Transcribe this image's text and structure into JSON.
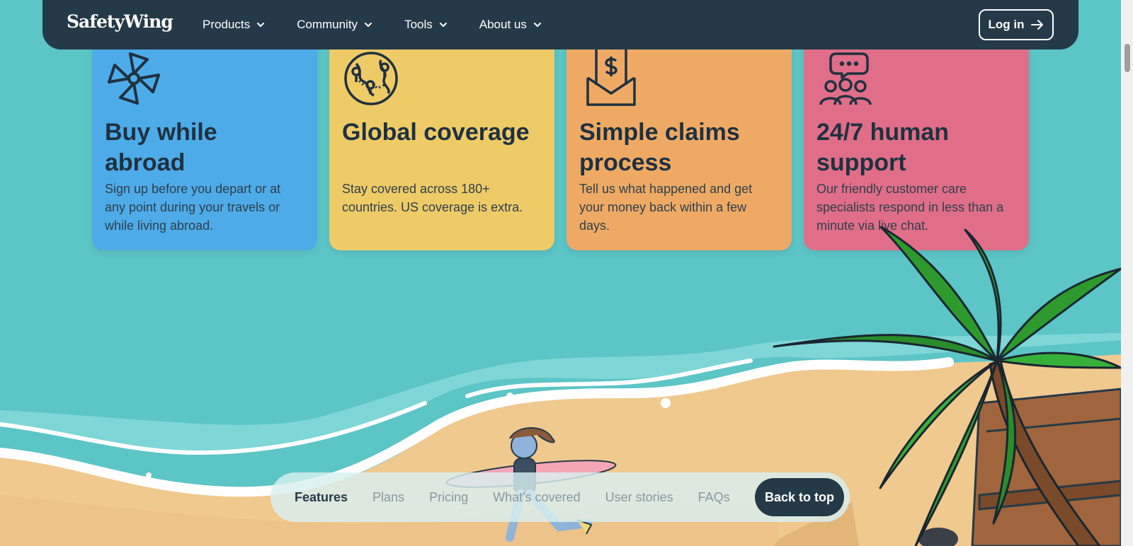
{
  "header": {
    "logo": "SafetyWing",
    "menu": [
      {
        "label": "Products"
      },
      {
        "label": "Community"
      },
      {
        "label": "Tools"
      },
      {
        "label": "About us"
      }
    ],
    "login_label": "Log in"
  },
  "features": [
    {
      "icon": "pinwheel-icon",
      "color": "#4eabe9",
      "title": "Buy while abroad",
      "text": "Sign up before you depart or at any point during your travels or while living abroad."
    },
    {
      "icon": "globe-map-icon",
      "color": "#eecb67",
      "title": "Global coverage",
      "text": "Stay covered across 180+ countries. US coverage is extra."
    },
    {
      "icon": "money-envelope-icon",
      "color": "#eeaa65",
      "title": "Simple claims process",
      "text": "Tell us what happened and get your money back within a few days."
    },
    {
      "icon": "support-chat-icon",
      "color": "#e06e88",
      "title": "24/7 human support",
      "text": "Our friendly customer care specialists respond in less than a minute via live chat."
    }
  ],
  "section_nav": {
    "items": [
      "Features",
      "Plans",
      "Pricing",
      "What's covered",
      "User stories",
      "FAQs"
    ],
    "active": "Features",
    "back_to_top": "Back to top"
  },
  "colors": {
    "nav_bg": "#253a48",
    "sea": "#5cc5c6",
    "sand": "#f0c98f"
  }
}
